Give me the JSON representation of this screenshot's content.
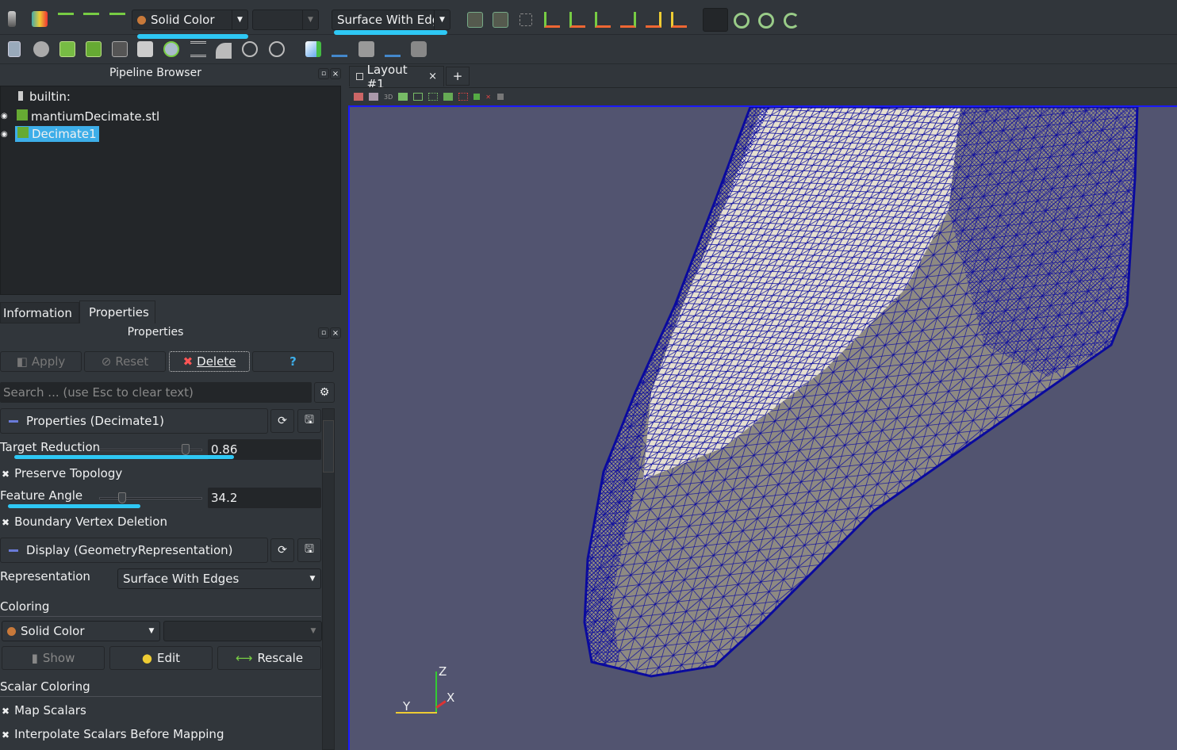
{
  "toolbar": {
    "color_by": "Solid Color",
    "color_component": "",
    "representation": "Surface With Edges",
    "representation_visible": "Surface With Edg",
    "row1_icons": [
      "toggle-color-legend-icon",
      "edit-color-map-icon",
      "rescale-range-icon",
      "rescale-custom-range-icon",
      "rescale-visible-range-icon"
    ],
    "camera_icons": [
      "reset-camera-icon",
      "reset-camera-closest-icon",
      "zoom-to-data-icon",
      "view-plus-x-icon",
      "view-minus-x-icon",
      "view-plus-y-icon",
      "view-minus-y-icon",
      "view-plus-z-icon",
      "view-minus-z-icon",
      "show-orientation-axes-icon",
      "rotate-90-cw-icon",
      "rotate-90-ccw-icon",
      "pick-center-icon"
    ],
    "camera_labels": [
      "+X",
      "-X",
      "+Y",
      "-Y",
      "+Z",
      "-Z"
    ],
    "row2_icons": [
      "calculator-icon",
      "contour-icon",
      "clip-icon",
      "slice-icon",
      "threshold-icon",
      "extract-subset-icon",
      "glyph-icon",
      "stream-tracer-icon",
      "warp-by-vector-icon",
      "group-datasets-icon",
      "extract-level-icon",
      "find-data-icon",
      "plot-over-time-icon",
      "plot-icon",
      "python-shell-icon",
      "view-icon"
    ]
  },
  "pipeline": {
    "title": "Pipeline Browser",
    "items": [
      {
        "label": "builtin:",
        "selected": false
      },
      {
        "label": "mantiumDecimate.stl",
        "selected": false,
        "visible": true
      },
      {
        "label": "Decimate1",
        "selected": true,
        "visible": true
      }
    ]
  },
  "tabs": {
    "information": "Information",
    "properties": "Properties"
  },
  "properties": {
    "title": "Properties",
    "apply": "Apply",
    "reset": "Reset",
    "delete": "Delete",
    "help": "?",
    "search_placeholder": "Search ... (use Esc to clear text)",
    "section1": "Properties (Decimate1)",
    "target_reduction_label": "Target Reduction",
    "target_reduction": "0.86",
    "target_reduction_fraction": 0.86,
    "preserve_topology": "Preserve Topology",
    "feature_angle_label": "Feature Angle",
    "feature_angle": "34.2",
    "feature_angle_fraction": 0.19,
    "boundary_vertex_deletion": "Boundary Vertex Deletion",
    "section2": "Display (GeometryRepresentation)",
    "representation_label": "Representation",
    "representation": "Surface With Edges",
    "coloring_label": "Coloring",
    "coloring": "Solid Color",
    "show": "Show",
    "edit": "Edit",
    "rescale": "Rescale",
    "scalar_coloring_label": "Scalar Coloring",
    "map_scalars": "Map Scalars",
    "interpolate_scalars": "Interpolate Scalars Before Mapping"
  },
  "layout": {
    "tab": "Layout #1",
    "close": "×",
    "add": "+",
    "view_toolbar_label": "3D"
  },
  "axes": {
    "z": "Z",
    "y": "Y",
    "x": "X"
  },
  "colors": {
    "viewport": "#525470",
    "mesh_edges": "#0a0a9e",
    "highlight": "#2ec8f5",
    "selection": "#3daee9"
  }
}
